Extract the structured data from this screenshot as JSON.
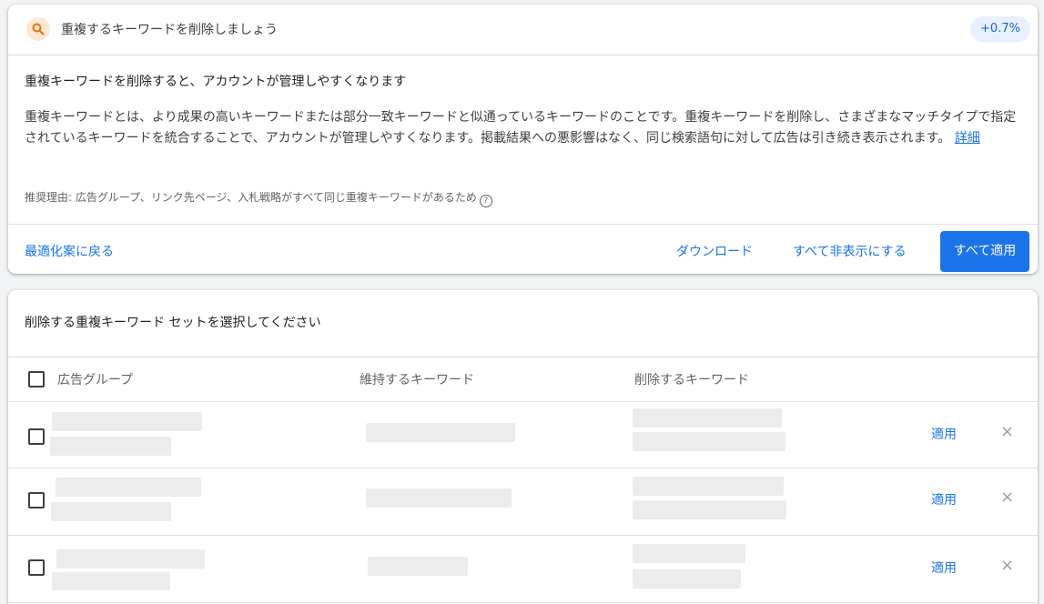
{
  "card": {
    "title": "重複するキーワードを削除しましょう",
    "uplift": "+0.7%",
    "headline": "重複キーワードを削除すると、アカウントが管理しやすくなります",
    "description": "重複キーワードとは、より成果の高いキーワードまたは部分一致キーワードと似通っているキーワードのことです。重複キーワードを削除し、さまざまなマッチタイプで指定されているキーワードを統合することで、アカウントが管理しやすくなります。掲載結果への悪影響はなく、同じ検索語句に対して広告は引き続き表示されます。",
    "details_link": "詳細",
    "reason": "推奨理由: 広告グループ、リンク先ページ、入札戦略がすべて同じ重複キーワードがあるため",
    "back_link": "最適化案に戻る",
    "download": "ダウンロード",
    "hide_all": "すべて非表示にする",
    "apply_all": "すべて適用"
  },
  "table": {
    "title": "削除する重複キーワード セットを選択してください",
    "col_adgroup": "広告グループ",
    "col_keep": "維持するキーワード",
    "col_remove": "削除するキーワード",
    "rows": [
      {
        "apply": "適用",
        "dismiss": "×"
      },
      {
        "apply": "適用",
        "dismiss": "×"
      },
      {
        "apply": "適用",
        "dismiss": "×"
      }
    ]
  },
  "colors": {
    "accent": "#1a73e8",
    "uplift_bg": "#e8f0fe",
    "placeholder": "#ececec"
  },
  "icons": {
    "header_icon": "search-icon",
    "help_icon": "help-circle-icon",
    "dismiss_icon": "close-icon"
  }
}
